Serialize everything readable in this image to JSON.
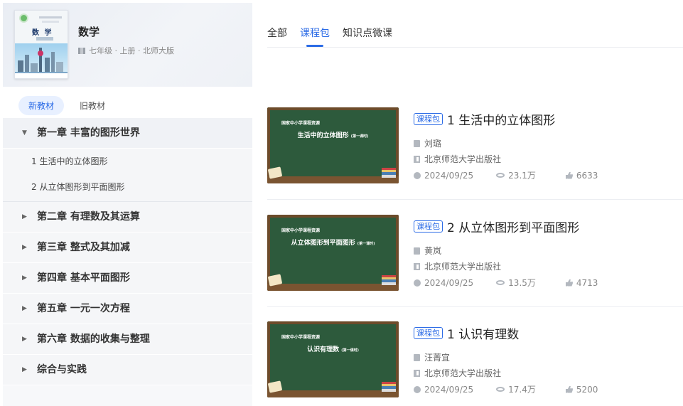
{
  "book": {
    "title": "数学",
    "meta": "七年级 · 上册 · 北师大版",
    "cover_title": "数 学"
  },
  "edition_tabs": [
    {
      "label": "新教材",
      "active": true
    },
    {
      "label": "旧教材",
      "active": false
    }
  ],
  "chapters": [
    {
      "label": "第一章 丰富的图形世界",
      "expanded": true,
      "lessons": [
        "1 生活中的立体图形",
        "2 从立体图形到平面图形"
      ]
    },
    {
      "label": "第二章 有理数及其运算",
      "expanded": false
    },
    {
      "label": "第三章 整式及其加减",
      "expanded": false
    },
    {
      "label": "第四章 基本平面图形",
      "expanded": false
    },
    {
      "label": "第五章 一元一次方程",
      "expanded": false
    },
    {
      "label": "第六章 数据的收集与整理",
      "expanded": false
    },
    {
      "label": "综合与实践",
      "expanded": false
    }
  ],
  "top_tabs": [
    {
      "label": "全部",
      "active": false
    },
    {
      "label": "课程包",
      "active": true
    },
    {
      "label": "知识点微课",
      "active": false
    }
  ],
  "courses": [
    {
      "badge": "课程包",
      "title": "1 生活中的立体图形",
      "teacher": "刘璐",
      "publisher": "北京师范大学出版社",
      "date": "2024/09/25",
      "views": "23.1万",
      "likes": "6633",
      "thumb": {
        "org": "国家中小学课程资源",
        "title": "生活中的立体图形",
        "sub": "(第一课时)"
      }
    },
    {
      "badge": "课程包",
      "title": "2 从立体图形到平面图形",
      "teacher": "黄岚",
      "publisher": "北京师范大学出版社",
      "date": "2024/09/25",
      "views": "13.5万",
      "likes": "4713",
      "thumb": {
        "org": "国家中小学课程资源",
        "title": "从立体图形到平面图形",
        "sub": "(第一课时)"
      }
    },
    {
      "badge": "课程包",
      "title": "1 认识有理数",
      "teacher": "汪菁宜",
      "publisher": "北京师范大学出版社",
      "date": "2024/09/25",
      "views": "17.4万",
      "likes": "5200",
      "thumb": {
        "org": "国家中小学课程资源",
        "title": "认识有理数",
        "sub": "(第一课时)"
      }
    }
  ],
  "colors": {
    "accent": "#2b6be6",
    "sidebar_bg": "#f7f8fa",
    "board": "#2d5a3c"
  }
}
